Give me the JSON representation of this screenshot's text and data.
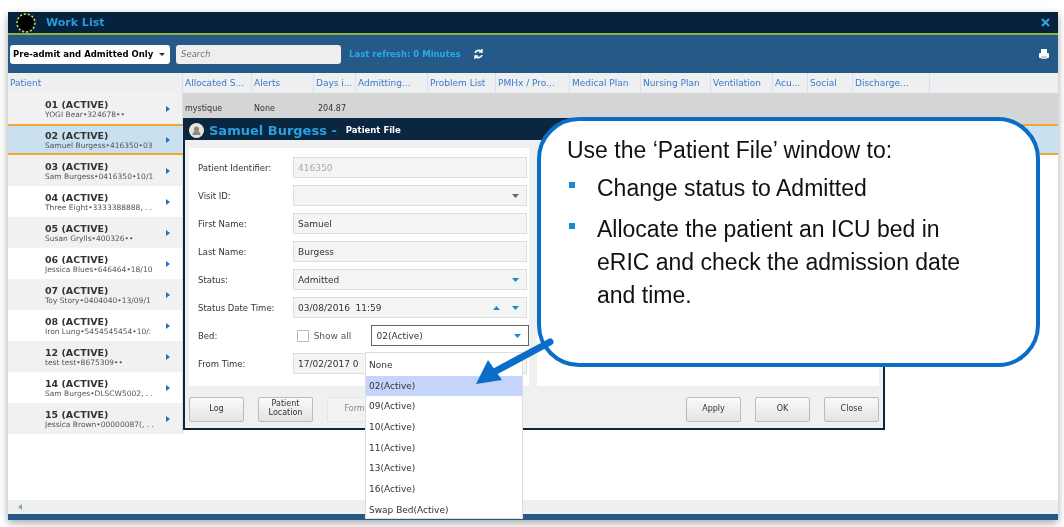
{
  "window": {
    "title": "Work List"
  },
  "toolbar": {
    "filter": "Pre-admit and Admitted Only",
    "search": {
      "placeholder": "Search"
    },
    "last_refresh": "Last refresh: 0 Minutes"
  },
  "table": {
    "columns": [
      "Patient",
      "Allocated S...",
      "Alerts",
      "Days i...",
      "Admitting...",
      "Problem List",
      "PMHx / Pro...",
      "Medical Plan",
      "Nursing Plan",
      "Ventilation",
      "Acu...",
      "Social",
      "Discharge..."
    ],
    "rows": [
      {
        "title": "01 (ACTIVE)",
        "detail": "YOGI Bear•324678••",
        "selected": false,
        "cells": [
          "mystique",
          "None",
          "204.87"
        ]
      },
      {
        "title": "02 (ACTIVE)",
        "detail": "Samuel Burgess•416350•03",
        "selected": true
      },
      {
        "title": "03 (ACTIVE)",
        "detail": "Sam Burgess•0416350•10/1",
        "selected": false
      },
      {
        "title": "04 (ACTIVE)",
        "detail": "Three Eight•3333388888, . .",
        "selected": false
      },
      {
        "title": "05 (ACTIVE)",
        "detail": "Susan Grylls•400326••",
        "selected": false
      },
      {
        "title": "06 (ACTIVE)",
        "detail": "Jessica Blues•646464•18/10",
        "selected": false
      },
      {
        "title": "07 (ACTIVE)",
        "detail": "Toy Story•0404040•13/09/1",
        "selected": false
      },
      {
        "title": "08 (ACTIVE)",
        "detail": "Iron Lung•5454545454•10/:",
        "selected": false
      },
      {
        "title": "12 (ACTIVE)",
        "detail": "test test•8675309••",
        "selected": false
      },
      {
        "title": "14 (ACTIVE)",
        "detail": "Sam Burges•DLSCW5002, . .",
        "selected": false
      },
      {
        "title": "15 (ACTIVE)",
        "detail": "Jessica Brown•00000087(, . .",
        "selected": false
      }
    ]
  },
  "dialog": {
    "name": "Samuel Burgess -",
    "title": "Patient File",
    "fields": [
      {
        "label": "Patient Identifier:",
        "kind": "readonly",
        "value": "416350"
      },
      {
        "label": "Visit ID:",
        "kind": "select"
      },
      {
        "label": "First Name:",
        "kind": "text",
        "value": "Samuel"
      },
      {
        "label": "Last Name:",
        "kind": "text",
        "value": "Burgess"
      },
      {
        "label": "Status:",
        "kind": "select",
        "value": "Admitted"
      },
      {
        "label": "Status Date  Time:",
        "kind": "datetime",
        "value": "03/08/2016  11:59"
      },
      {
        "label": "Bed:",
        "kind": "bed",
        "checkbox": {
          "label": "Show all",
          "checked": false
        },
        "value": "02(Active)"
      },
      {
        "label": "From Time:",
        "kind": "text",
        "value": "17/02/2017 0"
      }
    ],
    "dropdown": [
      {
        "label": "None",
        "selected": false
      },
      {
        "label": "02(Active)",
        "selected": true
      },
      {
        "label": "09(Active)",
        "selected": false
      },
      {
        "label": "10(Active)",
        "selected": false
      },
      {
        "label": "11(Active)",
        "selected": false
      },
      {
        "label": "13(Active)",
        "selected": false
      },
      {
        "label": "16(Active)",
        "selected": false
      },
      {
        "label": "Swap Bed(Active)",
        "selected": false
      }
    ],
    "buttons_left": [
      {
        "label": "Log",
        "disabled": false
      },
      {
        "label": "Patient Location",
        "disabled": false
      },
      {
        "label": "Form",
        "disabled": true
      }
    ],
    "buttons_right": [
      {
        "label": "Apply",
        "disabled": false
      },
      {
        "label": "OK",
        "disabled": false
      },
      {
        "label": "Close",
        "disabled": false
      }
    ]
  },
  "callout": {
    "heading": "Use the ‘Patient File’ window to:",
    "bullets": [
      "Change status to Admitted",
      "Allocate the patient an ICU bed in eRIC and check the admission date and time."
    ]
  }
}
